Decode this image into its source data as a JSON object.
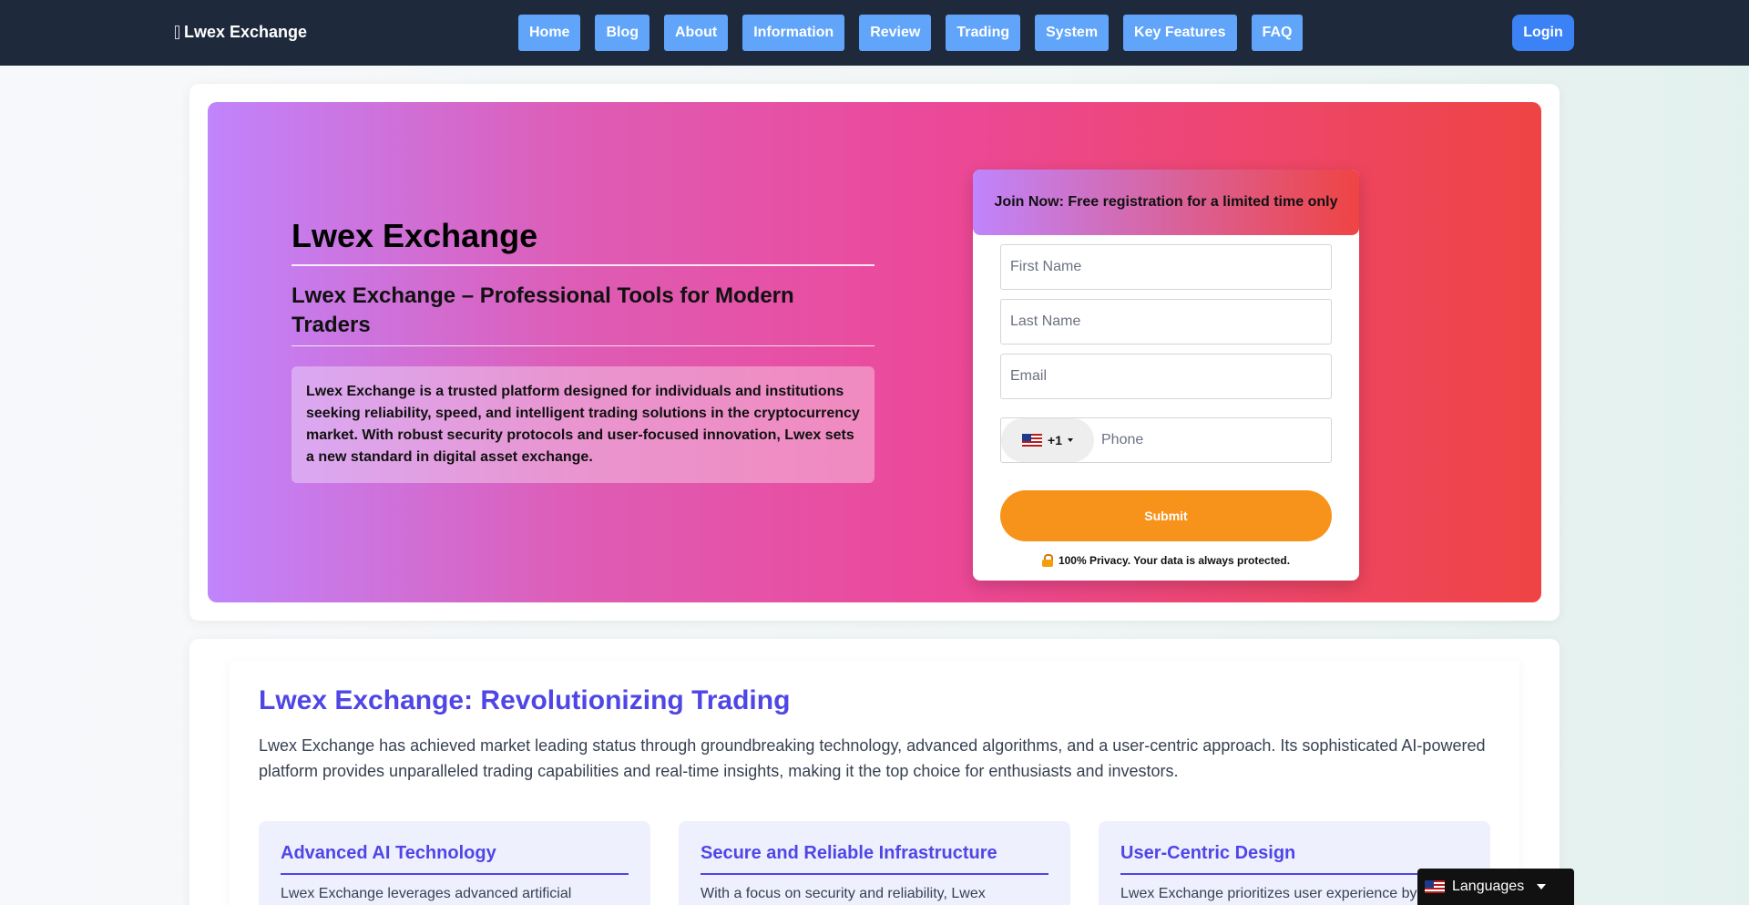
{
  "nav": {
    "brand": "Lwex Exchange",
    "links": [
      "Home",
      "Blog",
      "About",
      "Information",
      "Review",
      "Trading",
      "System",
      "Key Features",
      "FAQ"
    ],
    "login": "Login"
  },
  "hero": {
    "title": "Lwex Exchange",
    "subtitle": "Lwex Exchange – Professional Tools for Modern Traders",
    "description": "Lwex Exchange is a trusted platform designed for individuals and institutions seeking reliability, speed, and intelligent trading solutions in the cryptocurrency market. With robust security protocols and user-focused innovation, Lwex sets a new standard in digital asset exchange."
  },
  "form": {
    "header": "Join Now: Free registration for a limited time only",
    "first_name_placeholder": "First Name",
    "last_name_placeholder": "Last Name",
    "email_placeholder": "Email",
    "country_code": "+1",
    "phone_placeholder": "Phone",
    "submit": "Submit",
    "privacy": "100% Privacy. Your data is always protected."
  },
  "section": {
    "title": "Lwex Exchange: Revolutionizing Trading",
    "text": "Lwex Exchange has achieved market leading status through groundbreaking technology, advanced algorithms, and a user-centric approach. Its sophisticated AI-powered platform provides unparalleled trading capabilities and real-time insights, making it the top choice for enthusiasts and investors.",
    "features": [
      {
        "title": "Advanced AI Technology",
        "text": "Lwex Exchange leverages advanced artificial"
      },
      {
        "title": "Secure and Reliable Infrastructure",
        "text": "With a focus on security and reliability, Lwex"
      },
      {
        "title": "User-Centric Design",
        "text": "Lwex Exchange prioritizes user experience by"
      }
    ]
  },
  "languages": {
    "label": "Languages"
  },
  "colors": {
    "nav_bg": "#1e293b",
    "nav_link": "#60a5fa",
    "login": "#3b82f6",
    "submit": "#f7931a",
    "accent": "#4f46e5"
  }
}
